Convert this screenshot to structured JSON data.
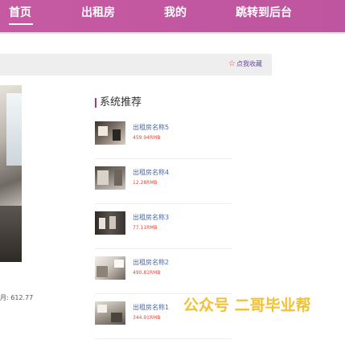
{
  "nav": {
    "items": [
      {
        "label": "首页"
      },
      {
        "label": "出租房"
      },
      {
        "label": "我的"
      },
      {
        "label": "跳转到后台"
      }
    ]
  },
  "detail": {
    "favorite_label": "点我收藏",
    "price_fragment": "月: 612.77"
  },
  "recommend": {
    "title": "系统推荐",
    "items": [
      {
        "name": "出租房名称5",
        "price": "459.94RMB"
      },
      {
        "name": "出租房名称4",
        "price": "12.28RMB"
      },
      {
        "name": "出租房名称3",
        "price": "77.11RMB"
      },
      {
        "name": "出租房名称2",
        "price": "490.81RMB"
      },
      {
        "name": "出租房名称1",
        "price": "344.91RMB"
      }
    ]
  },
  "watermark": {
    "text": "公众号 二哥毕业帮"
  },
  "colors": {
    "nav_bg": "#c45aa0",
    "accent": "#8e3f86",
    "price": "#e04a3a",
    "watermark": "#f2c132"
  }
}
